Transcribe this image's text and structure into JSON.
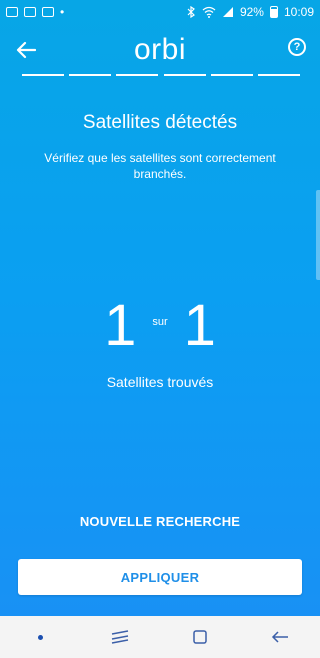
{
  "status_bar": {
    "battery": "92%",
    "time": "10:09"
  },
  "header": {
    "logo": "orbi",
    "help": "?"
  },
  "steps": {
    "count": 6
  },
  "main": {
    "title": "Satellites détectés",
    "subtitle": "Vérifiez que les satellites sont correctement branchés.",
    "found_count": "1",
    "separator": "sur",
    "total_count": "1",
    "found_label": "Satellites trouvés"
  },
  "actions": {
    "rescan_label": "NOUVELLE RECHERCHE",
    "apply_label": "APPLIQUER"
  },
  "colors": {
    "background_top": "#07a6e6",
    "background_bottom": "#1a8ff5",
    "accent": "#1f8fe8"
  }
}
